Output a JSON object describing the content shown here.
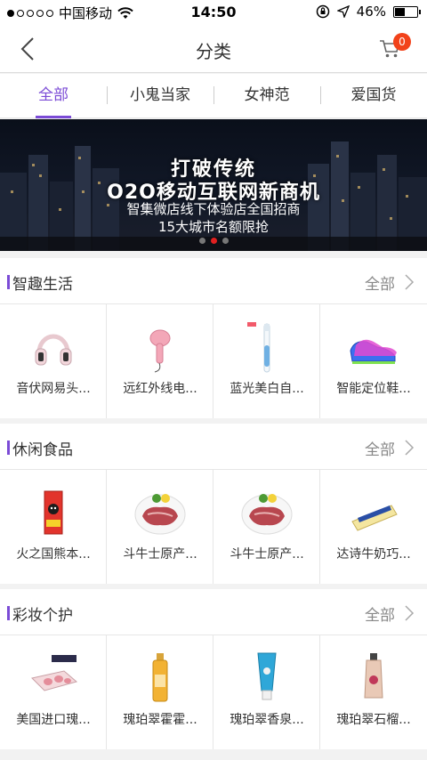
{
  "status": {
    "carrier": "中国移动",
    "time": "14:50",
    "battery": "46%",
    "battery_level": 0.46
  },
  "nav": {
    "title": "分类",
    "cart_count": "0"
  },
  "tabs": [
    {
      "label": "全部",
      "active": true
    },
    {
      "label": "小鬼当家",
      "active": false
    },
    {
      "label": "女神范",
      "active": false
    },
    {
      "label": "爱国货",
      "active": false
    }
  ],
  "banner": {
    "line1": "打破传统",
    "line2": "O2O移动互联网新商机",
    "line3": "智集微店线下体验店全国招商",
    "line4": "15大城市名额限抢"
  },
  "sections": [
    {
      "title": "智趣生活",
      "more": "全部",
      "items": [
        {
          "name": "音伏网易头...",
          "icon": "headphones-icon"
        },
        {
          "name": "远红外线电...",
          "icon": "hair-dryer-icon"
        },
        {
          "name": "蓝光美白自...",
          "icon": "toothbrush-icon"
        },
        {
          "name": "智能定位鞋...",
          "icon": "sneaker-icon"
        }
      ]
    },
    {
      "title": "休闲食品",
      "more": "全部",
      "items": [
        {
          "name": "火之国熊本...",
          "icon": "snack-bag-icon"
        },
        {
          "name": "斗牛士原产...",
          "icon": "steak-icon"
        },
        {
          "name": "斗牛士原产...",
          "icon": "steak-icon"
        },
        {
          "name": "达诗牛奶巧...",
          "icon": "chocolate-icon"
        }
      ]
    },
    {
      "title": "彩妆个护",
      "more": "全部",
      "items": [
        {
          "name": "美国进口瑰...",
          "icon": "soap-box-icon"
        },
        {
          "name": "瑰珀翠霍霍...",
          "icon": "oil-bottle-icon"
        },
        {
          "name": "瑰珀翠香泉...",
          "icon": "lotion-tube-icon"
        },
        {
          "name": "瑰珀翠石榴...",
          "icon": "cream-tube-icon"
        }
      ]
    }
  ]
}
